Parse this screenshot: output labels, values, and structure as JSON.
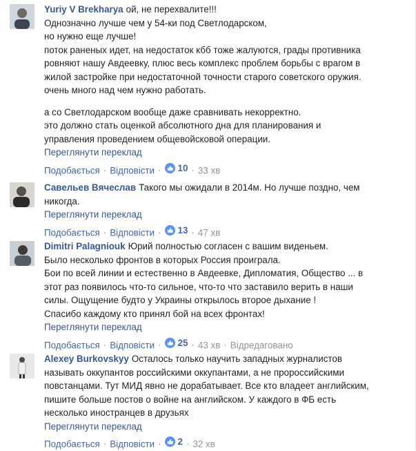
{
  "ui": {
    "translate_label": "Переглянути переклад",
    "like_label": "Подобається",
    "reply_label": "Відповісти",
    "dot": "·"
  },
  "comments": [
    {
      "author": "Yuriy V Brekharya",
      "lines": [
        "ой, не перехвалите!!!",
        "Однозначно лучше чем у 54-ки под Светлодарском,",
        "но нужно еще лучше!",
        "поток раненых идет, на недостаток кбб тоже жалуются, грады противника",
        "ровняют нашу Авдеевку, плюс весь комплекс проблем борьбы с врагом в",
        "жилой застройке при недостаточной точности старого советского оружия.",
        "очень много над чем нужно работать.",
        "а со Светлодарском вообще даже сравнивать некорректно.",
        "это должно стать оценкой абсолютного дна для планирования и",
        "управления проведением общевойсковой операции."
      ],
      "likes": "10",
      "time": "33 хв"
    },
    {
      "author": "Савельев Вячеслав",
      "lines": [
        "Такого мы ожидали в 2014м. Но лучше поздно, чем",
        "никогда."
      ],
      "likes": "13",
      "time": "47 хв"
    },
    {
      "author": "Dimitri Palagniouk",
      "lines": [
        "Юрий полностью согласен с вашим виденьем.",
        "Было несколько фронтов в которых Россия проиграла.",
        "Бои по всей линии и естественно в Авдеевке, Дипломатия, Общество ... в",
        "этот раз появилось что-то сильное, что-то что заставило верить в наши",
        "силы. Ощущение будто у Украины открылось второе дыхание !",
        "Спасибо каждому кто принял бой на всех фронтах!"
      ],
      "likes": "25",
      "time": "43 хв",
      "edited": "Відредаговано"
    },
    {
      "author": "Alexey Burkovskyy",
      "lines": [
        "Осталось только научить западных журналистов",
        "называть оккупантов российскими оккупантами, а не пророссийскими",
        "повстанцами. Тут МИД явно не дорабатывает. Все кто владеет английским,",
        "пишите больше постов о войне на английском. У каждого в ФБ есть",
        "несколько иностранцев в друзьях"
      ],
      "likes": "2",
      "time": "32 хв"
    }
  ],
  "colors": {
    "link": "#365899",
    "action": "#4267b2",
    "meta": "#90949c",
    "like_badge": "#5890ff"
  }
}
